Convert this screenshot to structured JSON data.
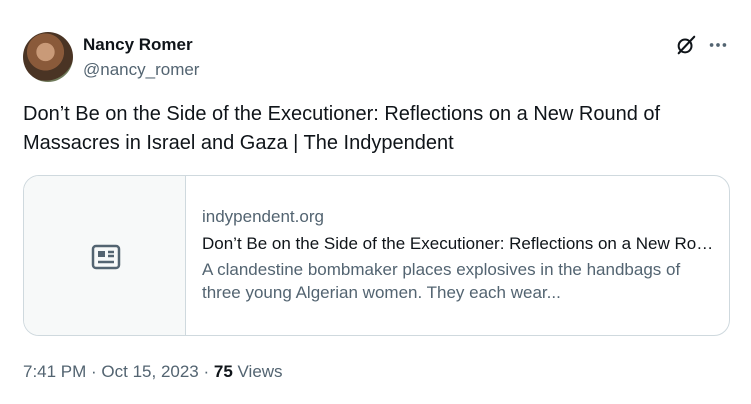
{
  "author": {
    "name": "Nancy Romer",
    "handle": "@nancy_romer"
  },
  "icons": {
    "grok": "grok-icon",
    "more": "more-horizontal-icon",
    "article": "article-icon"
  },
  "tweet": {
    "text": "Don’t Be on the Side of the Executioner: Reflections on a New Round of Massacres in Israel and Gaza | The Indypendent"
  },
  "card": {
    "domain": "indypendent.org",
    "title": "Don’t Be on the Side of the Executioner: Reflections on a New Round of Massacres in Israel and Gaza",
    "description": "A clandestine bombmaker places explosives in the handbags of three young Algerian women. They each wear..."
  },
  "meta": {
    "timestamp": "7:41 PM · Oct 15, 2023",
    "separator": " · ",
    "views_count": "75",
    "views_label": " Views"
  },
  "colors": {
    "text": "#0f1419",
    "secondary": "#536471",
    "border": "#cfd9de"
  }
}
